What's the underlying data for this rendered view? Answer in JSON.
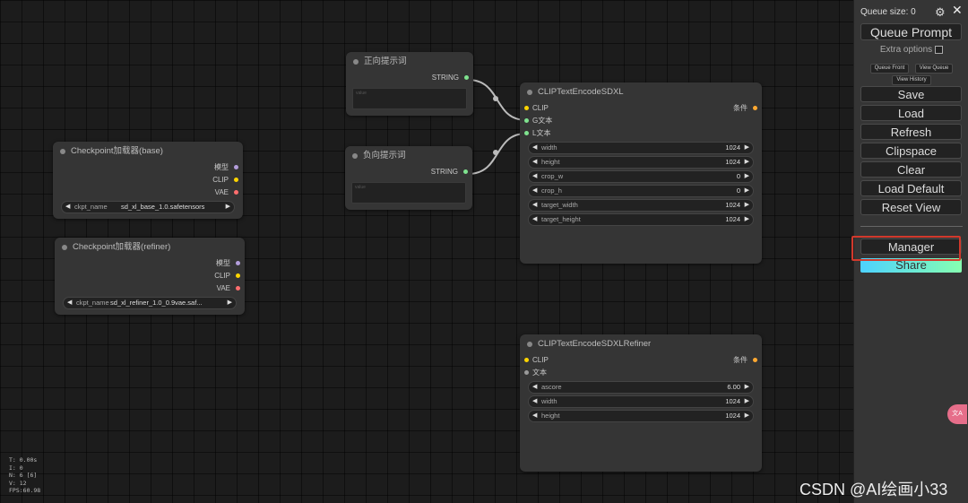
{
  "nodes": {
    "ckpt_base": {
      "title": "Checkpoint加载器(base)",
      "outputs": [
        "模型",
        "CLIP",
        "VAE"
      ],
      "widget": {
        "name": "ckpt_name",
        "value": "sd_xl_base_1.0.safetensors"
      }
    },
    "ckpt_refiner": {
      "title": "Checkpoint加载器(refiner)",
      "outputs": [
        "模型",
        "CLIP",
        "VAE"
      ],
      "widget": {
        "name": "ckpt_name",
        "value": "sd_xl_refiner_1.0_0.9vae.saf..."
      }
    },
    "pos_prompt": {
      "title": "正向提示词",
      "output": "STRING",
      "placeholder": "value"
    },
    "neg_prompt": {
      "title": "负向提示词",
      "output": "STRING",
      "placeholder": "value"
    },
    "sdxl_encode": {
      "title": "CLIPTextEncodeSDXL",
      "inputs": [
        "CLIP",
        "G文本",
        "L文本"
      ],
      "output": "条件",
      "widgets": [
        {
          "name": "width",
          "value": "1024"
        },
        {
          "name": "height",
          "value": "1024"
        },
        {
          "name": "crop_w",
          "value": "0"
        },
        {
          "name": "crop_h",
          "value": "0"
        },
        {
          "name": "target_width",
          "value": "1024"
        },
        {
          "name": "target_height",
          "value": "1024"
        }
      ]
    },
    "sdxl_refiner": {
      "title": "CLIPTextEncodeSDXLRefiner",
      "inputs": [
        "CLIP",
        "文本"
      ],
      "output": "条件",
      "widgets": [
        {
          "name": "ascore",
          "value": "6.00"
        },
        {
          "name": "width",
          "value": "1024"
        },
        {
          "name": "height",
          "value": "1024"
        }
      ]
    }
  },
  "menu": {
    "queue_size": "Queue size: 0",
    "queue_prompt": "Queue Prompt",
    "extra_options": "Extra options",
    "queue_front": "Queue Front",
    "view_queue": "View Queue",
    "view_history": "View History",
    "save": "Save",
    "load": "Load",
    "refresh": "Refresh",
    "clipspace": "Clipspace",
    "clear": "Clear",
    "load_default": "Load Default",
    "reset_view": "Reset View",
    "manager": "Manager",
    "share": "Share"
  },
  "stats": [
    "T: 0.00s",
    "I: 0",
    "N: 6 [6]",
    "V: 12",
    "FPS:60.98"
  ],
  "watermark": "CSDN @AI绘画小33",
  "translate_badge": "文A"
}
